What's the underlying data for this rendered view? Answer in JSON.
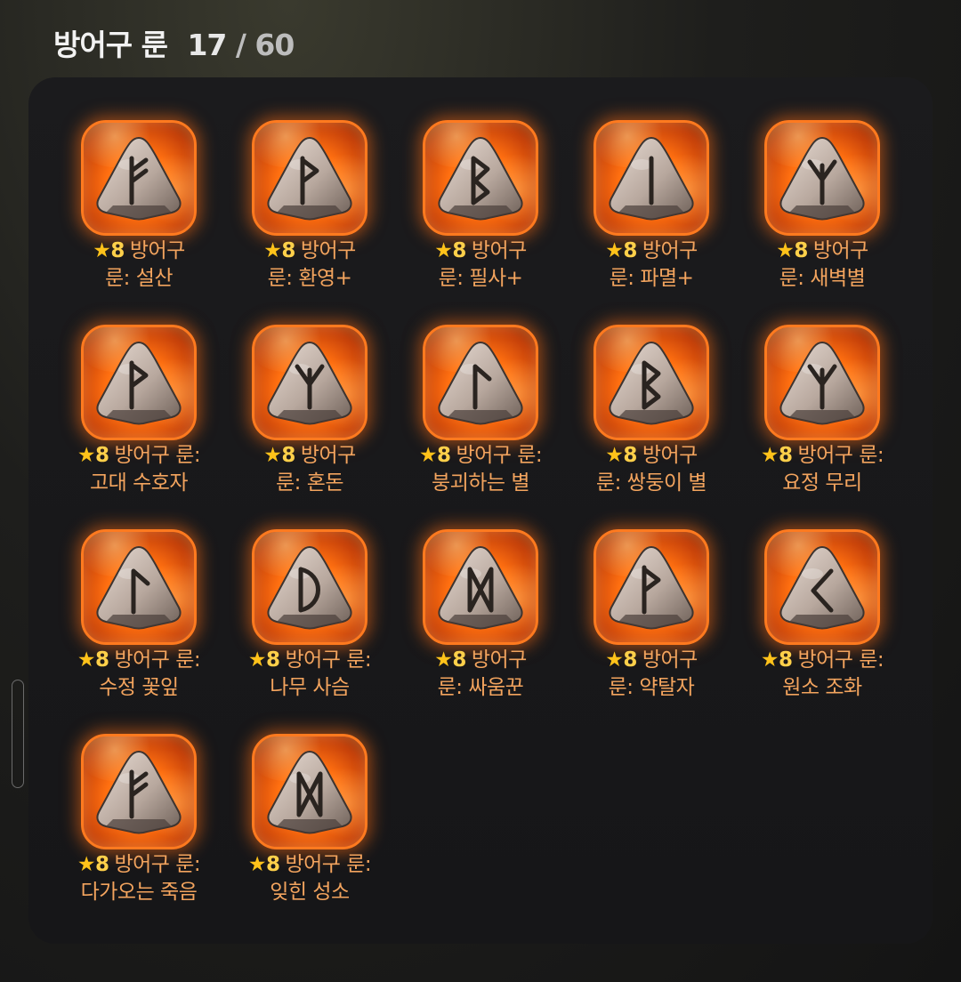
{
  "header": {
    "title": "방어구 룬",
    "count_current": "17",
    "count_total": " / 60"
  },
  "colors": {
    "accent_orange": "#ff7a1f",
    "label_orange": "#f3a45e",
    "star_gold": "#ffc21a"
  },
  "items": [
    {
      "star": "★",
      "grade": "8",
      "line1": "방어구",
      "line2": "룬: 설산",
      "rune": "fehu"
    },
    {
      "star": "★",
      "grade": "8",
      "line1": "방어구",
      "line2": "룬: 환영+",
      "rune": "wunjo"
    },
    {
      "star": "★",
      "grade": "8",
      "line1": "방어구",
      "line2": "룬: 필사+",
      "rune": "berkano"
    },
    {
      "star": "★",
      "grade": "8",
      "line1": "방어구",
      "line2": "룬: 파멸+",
      "rune": "isa"
    },
    {
      "star": "★",
      "grade": "8",
      "line1": "방어구",
      "line2": "룬: 새벽별",
      "rune": "algiz"
    },
    {
      "star": "★",
      "grade": "8",
      "line1": "방어구 룬:",
      "line2": "고대 수호자",
      "rune": "wunjo"
    },
    {
      "star": "★",
      "grade": "8",
      "line1": "방어구",
      "line2": "룬: 혼돈",
      "rune": "algiz"
    },
    {
      "star": "★",
      "grade": "8",
      "line1": "방어구 룬:",
      "line2": "붕괴하는 별",
      "rune": "laguz"
    },
    {
      "star": "★",
      "grade": "8",
      "line1": "방어구",
      "line2": "룬: 쌍둥이 별",
      "rune": "berkano"
    },
    {
      "star": "★",
      "grade": "8",
      "line1": "방어구 룬:",
      "line2": "요정 무리",
      "rune": "algiz"
    },
    {
      "star": "★",
      "grade": "8",
      "line1": "방어구 룬:",
      "line2": "수정 꽃잎",
      "rune": "laguz"
    },
    {
      "star": "★",
      "grade": "8",
      "line1": "방어구 룬:",
      "line2": "나무 사슴",
      "rune": "dagaz"
    },
    {
      "star": "★",
      "grade": "8",
      "line1": "방어구",
      "line2": "룬: 싸움꾼",
      "rune": "dagaz2"
    },
    {
      "star": "★",
      "grade": "8",
      "line1": "방어구",
      "line2": "룬: 약탈자",
      "rune": "wunjo"
    },
    {
      "star": "★",
      "grade": "8",
      "line1": "방어구 룬:",
      "line2": "원소 조화",
      "rune": "kenaz"
    },
    {
      "star": "★",
      "grade": "8",
      "line1": "방어구 룬:",
      "line2": "다가오는 죽음",
      "rune": "fehu"
    },
    {
      "star": "★",
      "grade": "8",
      "line1": "방어구 룬:",
      "line2": "잊힌 성소",
      "rune": "dagaz2"
    }
  ]
}
